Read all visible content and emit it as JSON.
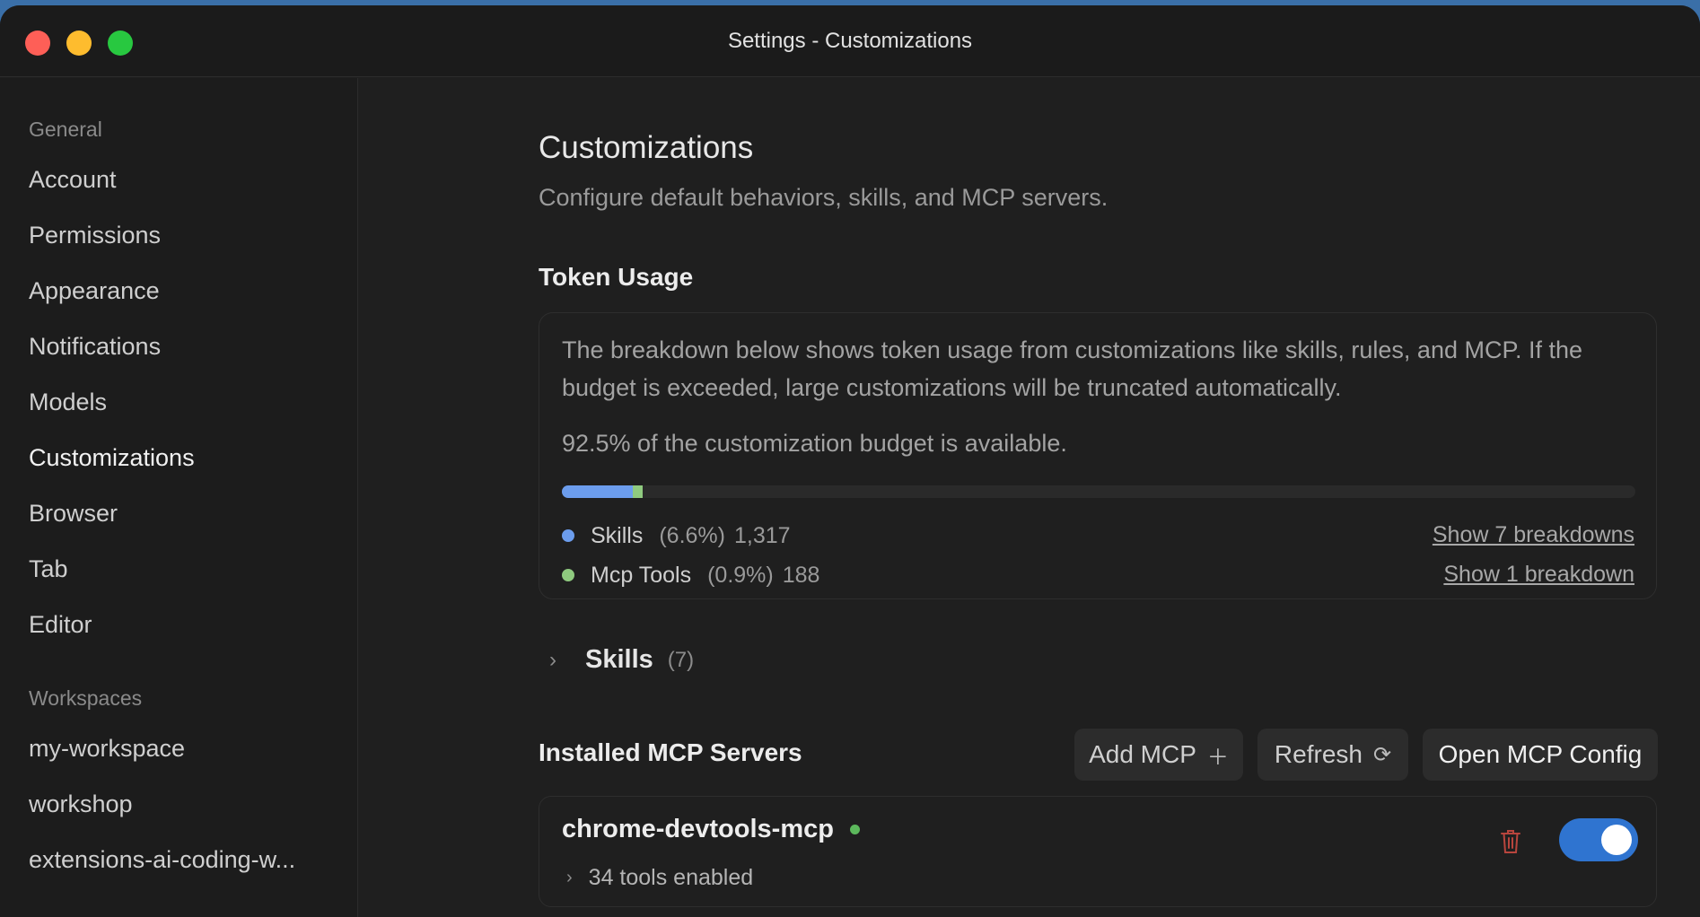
{
  "window": {
    "title": "Settings - Customizations"
  },
  "sidebar": {
    "groups": [
      {
        "label": "General",
        "items": [
          "Account",
          "Permissions",
          "Appearance",
          "Notifications",
          "Models",
          "Customizations",
          "Browser",
          "Tab",
          "Editor"
        ]
      },
      {
        "label": "Workspaces",
        "items": [
          "my-workspace",
          "workshop",
          "extensions-ai-coding-w..."
        ]
      }
    ],
    "active": "Customizations"
  },
  "main": {
    "title": "Customizations",
    "subtitle": "Configure default behaviors, skills, and MCP servers.",
    "token_usage": {
      "heading": "Token Usage",
      "description": "The breakdown below shows token usage from customizations like skills, rules, and MCP. If the budget is exceeded, large customizations will be truncated automatically.",
      "available_text": "92.5% of the customization budget is available.",
      "available_percent": 92.5,
      "segments": [
        {
          "name": "Skills",
          "percent_label": "(6.6%)",
          "tokens": "1,317",
          "percent": 6.6,
          "color": "#6c9ded",
          "link": "Show 7 breakdowns"
        },
        {
          "name": "Mcp Tools",
          "percent_label": "(0.9%)",
          "tokens": "188",
          "percent": 0.9,
          "color": "#8fca7f",
          "link": "Show 1 breakdown"
        }
      ]
    },
    "skills": {
      "label": "Skills",
      "count": "(7)"
    },
    "mcp": {
      "heading": "Installed MCP Servers",
      "buttons": {
        "add": "Add MCP",
        "refresh": "Refresh",
        "open": "Open MCP Config"
      },
      "servers": [
        {
          "name": "chrome-devtools-mcp",
          "status_color": "#5cb85c",
          "tools": "34 tools enabled",
          "enabled": true
        }
      ]
    }
  },
  "icons": {
    "plus": "plus-icon",
    "refresh": "refresh-icon",
    "trash": "trash-icon",
    "chevron": "chevron-right-icon"
  },
  "colors": {
    "toggle_on": "#2f74d0",
    "trash": "#b8453d"
  }
}
